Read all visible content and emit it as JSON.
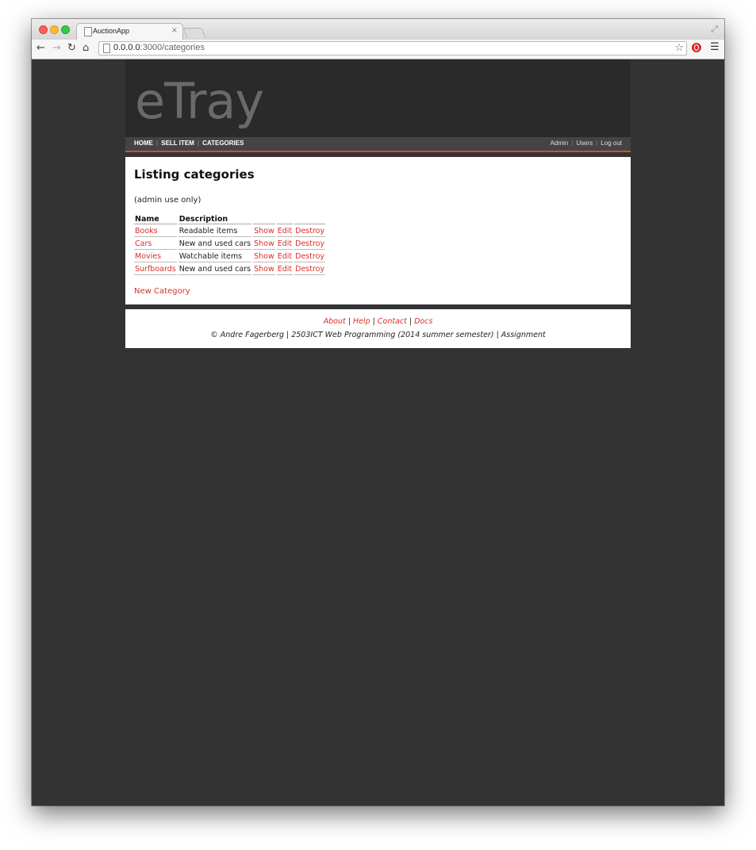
{
  "browser": {
    "tab_title": "AuctionApp",
    "tab_close": "×",
    "url_host": "0.0.0.0",
    "url_rest": ":3000/categories"
  },
  "site": {
    "logo": "eTray",
    "nav_left": [
      "HOME",
      "SELL ITEM",
      "CATEGORIES"
    ],
    "nav_right": [
      "Admin",
      "Users",
      "Log out"
    ]
  },
  "main": {
    "title": "Listing categories",
    "note": "(admin use only)",
    "table": {
      "headers": [
        "Name",
        "Description"
      ],
      "rows": [
        {
          "name": "Books",
          "description": "Readable items",
          "show": "Show",
          "edit": "Edit",
          "destroy": "Destroy"
        },
        {
          "name": "Cars",
          "description": "New and used cars",
          "show": "Show",
          "edit": "Edit",
          "destroy": "Destroy"
        },
        {
          "name": "Movies",
          "description": "Watchable items",
          "show": "Show",
          "edit": "Edit",
          "destroy": "Destroy"
        },
        {
          "name": "Surfboards",
          "description": "New and used cars",
          "show": "Show",
          "edit": "Edit",
          "destroy": "Destroy"
        }
      ]
    },
    "new_link": "New Category"
  },
  "footer": {
    "links": [
      "About",
      "Help",
      "Contact",
      "Docs"
    ],
    "separator": "|",
    "credit": "© Andre Fagerberg | 2503ICT Web Programming (2014 summer semester) | Assignment"
  },
  "colors": {
    "accent": "#d9302a",
    "page_background": "#333333",
    "header_background": "#2a2a2a",
    "logo": "#6a6a6a"
  }
}
